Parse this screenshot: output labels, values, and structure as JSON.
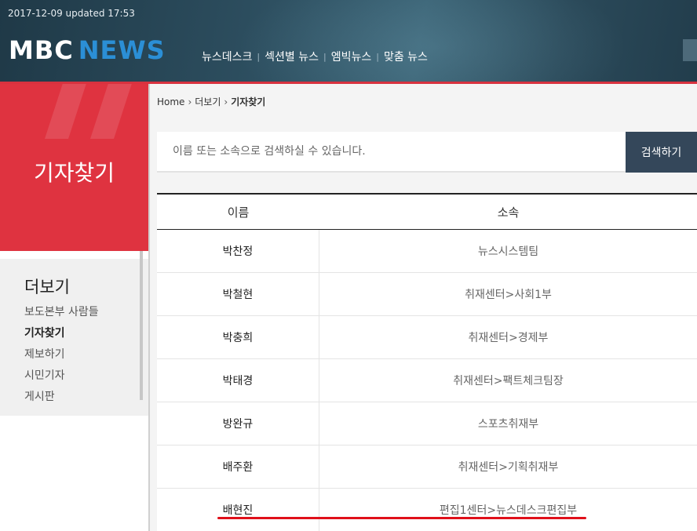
{
  "header": {
    "updated": "2017-12-09 updated 17:53",
    "logo_mbc": "MBC",
    "logo_news": "NEWS",
    "nav": [
      "뉴스데스크",
      "섹션별 뉴스",
      "엠빅뉴스",
      "맞춤 뉴스"
    ],
    "nav_separator": "|"
  },
  "sidebar": {
    "page_title": "기자찾기",
    "menu_title": "더보기",
    "items": [
      {
        "label": "보도본부 사람들",
        "active": false
      },
      {
        "label": "기자찾기",
        "active": true
      },
      {
        "label": "제보하기",
        "active": false
      },
      {
        "label": "시민기자",
        "active": false
      },
      {
        "label": "게시판",
        "active": false
      }
    ]
  },
  "breadcrumb": {
    "home": "Home",
    "level1": "더보기",
    "current": "기자찾기"
  },
  "search": {
    "placeholder": "이름 또는 소속으로 검색하실 수 있습니다.",
    "value": "",
    "button_label": "검색하기"
  },
  "table": {
    "headers": [
      "이름",
      "소속"
    ],
    "rows": [
      [
        "박찬정",
        "뉴스시스템팀"
      ],
      [
        "박철현",
        "취재센터>사회1부"
      ],
      [
        "박충희",
        "취재센터>경제부"
      ],
      [
        "박태경",
        "취재센터>팩트체크팀장"
      ],
      [
        "방완규",
        "스포츠취재부"
      ],
      [
        "배주환",
        "취재센터>기획취재부"
      ],
      [
        "배현진",
        "편집1센터>뉴스데스크편집부"
      ]
    ]
  },
  "colors": {
    "accent_red": "#df3340",
    "header_bg": "#2c4d5e",
    "search_button": "#34475a",
    "highlight_underline": "#e0101a"
  }
}
